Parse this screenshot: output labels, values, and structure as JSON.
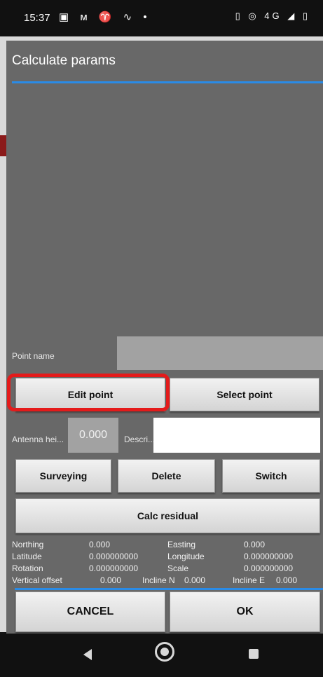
{
  "status_bar": {
    "time": "15:37",
    "left_icons": "▣ ᴍ ♈ ∿ •",
    "right_icons": "▯ ◎ 4G ◢ ▯"
  },
  "dialog": {
    "title": "Calculate params",
    "point_name_label": "Point name",
    "point_name_value": "",
    "buttons": {
      "edit_point": "Edit point",
      "select_point": "Select point",
      "surveying": "Surveying",
      "delete": "Delete",
      "switch": "Switch",
      "calc_residual": "Calc residual",
      "cancel": "CANCEL",
      "ok": "OK"
    },
    "antenna_label": "Antenna hei...",
    "antenna_value": "0.000",
    "description_label": "Descri...",
    "description_value": "",
    "info": {
      "northing_label": "Northing",
      "northing_value": "0.000",
      "easting_label": "Easting",
      "easting_value": "0.000",
      "latitude_label": "Latitude",
      "latitude_value": "0.000000000",
      "longitude_label": "Longitude",
      "longitude_value": "0.000000000",
      "rotation_label": "Rotation",
      "rotation_value": "0.000000000",
      "scale_label": "Scale",
      "scale_value": "0.000000000",
      "vertical_offset_label": "Vertical offset",
      "vertical_offset_value": "0.000",
      "incline_n_label": "Incline N",
      "incline_n_value": "0.000",
      "incline_e_label": "Incline E",
      "incline_e_value": "0.000"
    }
  },
  "colors": {
    "dialog_bg": "#686868",
    "accent": "#2a8be6",
    "highlight": "#e41b1b"
  }
}
